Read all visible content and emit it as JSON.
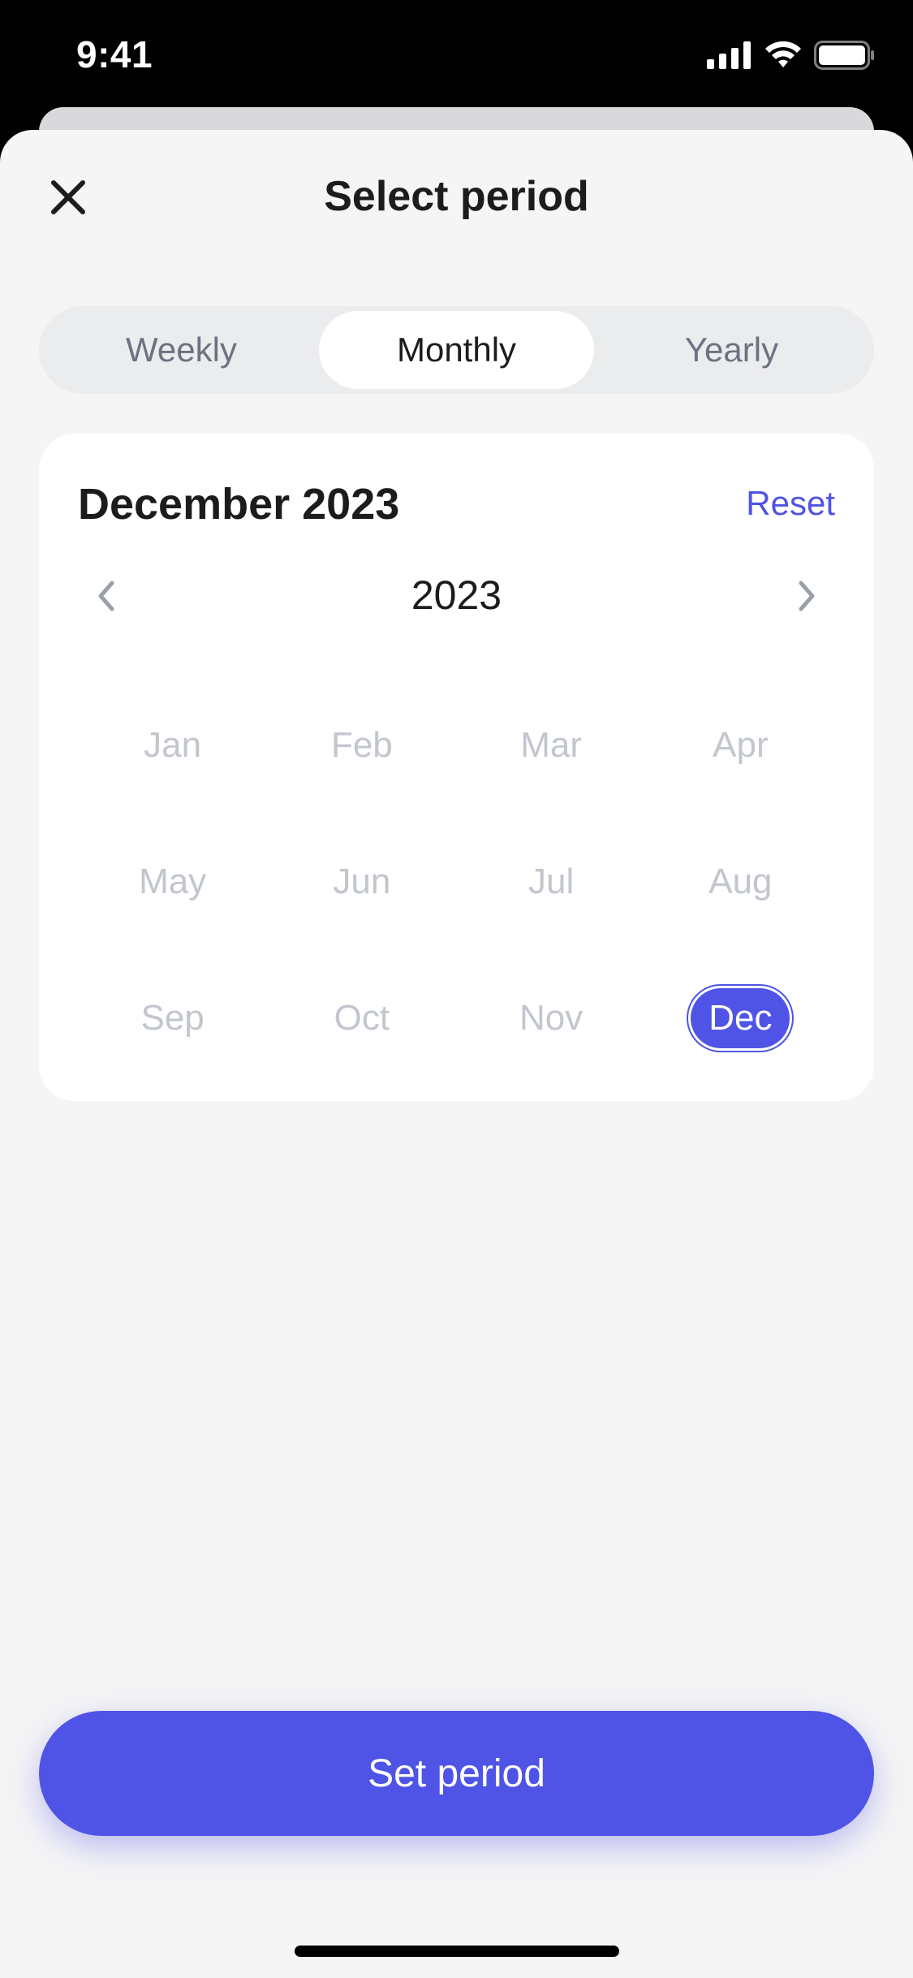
{
  "status": {
    "time": "9:41"
  },
  "header": {
    "title": "Select period"
  },
  "tabs": [
    {
      "label": "Weekly",
      "active": false
    },
    {
      "label": "Monthly",
      "active": true
    },
    {
      "label": "Yearly",
      "active": false
    }
  ],
  "calendar": {
    "selected_label": "December 2023",
    "reset_label": "Reset",
    "year": "2023",
    "months": [
      "Jan",
      "Feb",
      "Mar",
      "Apr",
      "May",
      "Jun",
      "Jul",
      "Aug",
      "Sep",
      "Oct",
      "Nov",
      "Dec"
    ],
    "selected_month": "Dec"
  },
  "cta": {
    "label": "Set period"
  },
  "colors": {
    "accent": "#4f54e6",
    "muted": "#c2c6cd",
    "background": "#f5f5f6"
  }
}
